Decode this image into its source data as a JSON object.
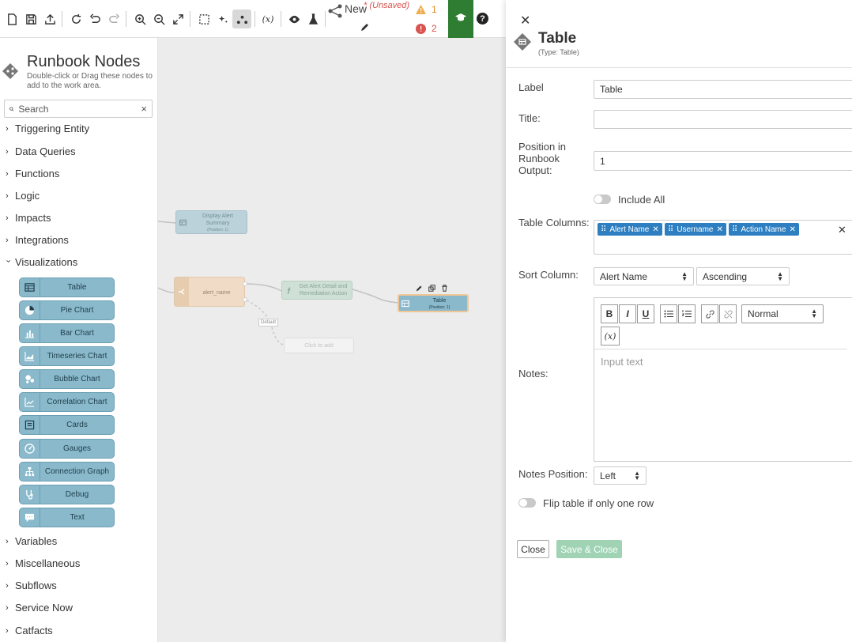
{
  "toolbar": {
    "flow_name": "New",
    "unsaved": "* (Unsaved)",
    "warnings_count": "1",
    "errors_count": "2",
    "variables_label": "(x)",
    "help_label": "?"
  },
  "palette": {
    "title": "Runbook Nodes",
    "subtitle": "Double-click or Drag these nodes to add to the work area.",
    "search_placeholder": "Search",
    "categories_top": [
      "Triggering Entity",
      "Data Queries",
      "Functions",
      "Logic",
      "Impacts",
      "Integrations",
      "Visualizations"
    ],
    "visualization_nodes": [
      {
        "label": "Table",
        "icon": "table-icon"
      },
      {
        "label": "Pie Chart",
        "icon": "pie-chart-icon"
      },
      {
        "label": "Bar Chart",
        "icon": "bar-chart-icon"
      },
      {
        "label": "Timeseries Chart",
        "icon": "timeseries-chart-icon"
      },
      {
        "label": "Bubble Chart",
        "icon": "bubble-chart-icon"
      },
      {
        "label": "Correlation Chart",
        "icon": "correlation-chart-icon"
      },
      {
        "label": "Cards",
        "icon": "cards-icon"
      },
      {
        "label": "Gauges",
        "icon": "gauge-icon"
      },
      {
        "label": "Connection Graph",
        "icon": "connection-graph-icon"
      },
      {
        "label": "Debug",
        "icon": "debug-icon"
      },
      {
        "label": "Text",
        "icon": "text-icon"
      }
    ],
    "categories_bottom": [
      "Variables",
      "Miscellaneous",
      "Subflows",
      "Service Now",
      "Catfacts"
    ]
  },
  "canvas": {
    "display_alert": {
      "label": "Display Alert Summary",
      "sub": "(Position: 1)"
    },
    "alert_name": {
      "label": "alert_name"
    },
    "get_alert": {
      "label": "Get Alert Detail and Remediation Action"
    },
    "table_node": {
      "label": "Table",
      "sub": "(Position: 1)"
    },
    "default_edge": "Default",
    "click_to_add": "Click to add"
  },
  "panel": {
    "title": "Table",
    "type": "(Type: Table)",
    "label_label": "Label",
    "label_value": "Table",
    "title_label": "Title:",
    "title_value": "",
    "position_label": "Position in Runbook Output:",
    "position_value": "1",
    "include_all": "Include All",
    "columns_label": "Table Columns:",
    "columns": [
      "Alert Name",
      "Username",
      "Action Name"
    ],
    "sort_label": "Sort Column:",
    "sort_column": "Alert Name",
    "sort_order": "Ascending",
    "notes_label": "Notes:",
    "bold": "B",
    "italic": "I",
    "underline": "U",
    "format": "Normal",
    "variable": "(x)",
    "notes_placeholder": "Input text",
    "notes_position_label": "Notes Position:",
    "notes_position": "Left",
    "flip_table": "Flip table if only one row",
    "close": "Close",
    "save_close": "Save & Close"
  },
  "colors": {
    "node_fill": "#8ab9cb",
    "ribbon": "#2e7d32",
    "tag": "#2d7fc1",
    "save_button": "#9fd3b4",
    "warning": "#f0ad4e",
    "error": "#d9534f"
  }
}
